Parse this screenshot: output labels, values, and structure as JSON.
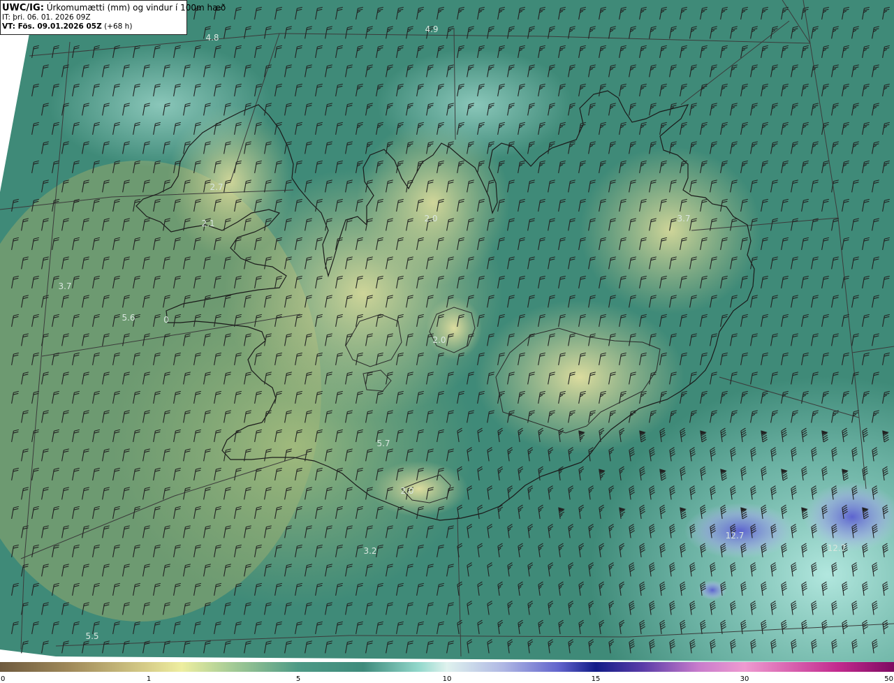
{
  "header": {
    "model": "UWC/IG:",
    "title": "Úrkomumætti (mm) og vindur í 100m hæð",
    "it_label": "IT:",
    "it_value": "þri. 06. 01. 2026 09Z",
    "vt_label": "VT: Fös. 09.01.2026 05Z",
    "vt_offset": "(+68 h)"
  },
  "map_values": [
    "4.8",
    "4.9",
    "2.7",
    "2.1",
    "2.0",
    "3.7",
    "3.7",
    "5.6",
    "0",
    "2.0",
    "5.7",
    "2.0",
    "3.2",
    "12.7",
    "12.7",
    "5.5"
  ],
  "colorbar": {
    "ticks": [
      "0",
      "1",
      "5",
      "10",
      "15",
      "30",
      "50"
    ]
  },
  "colors": {
    "dry": "#d9d99a",
    "moderate": "#4e9a86",
    "wet": "#b4e6dc",
    "heavy": "#6264cc",
    "coastline": "#1a1a1a",
    "grid": "#3b3b3b"
  }
}
